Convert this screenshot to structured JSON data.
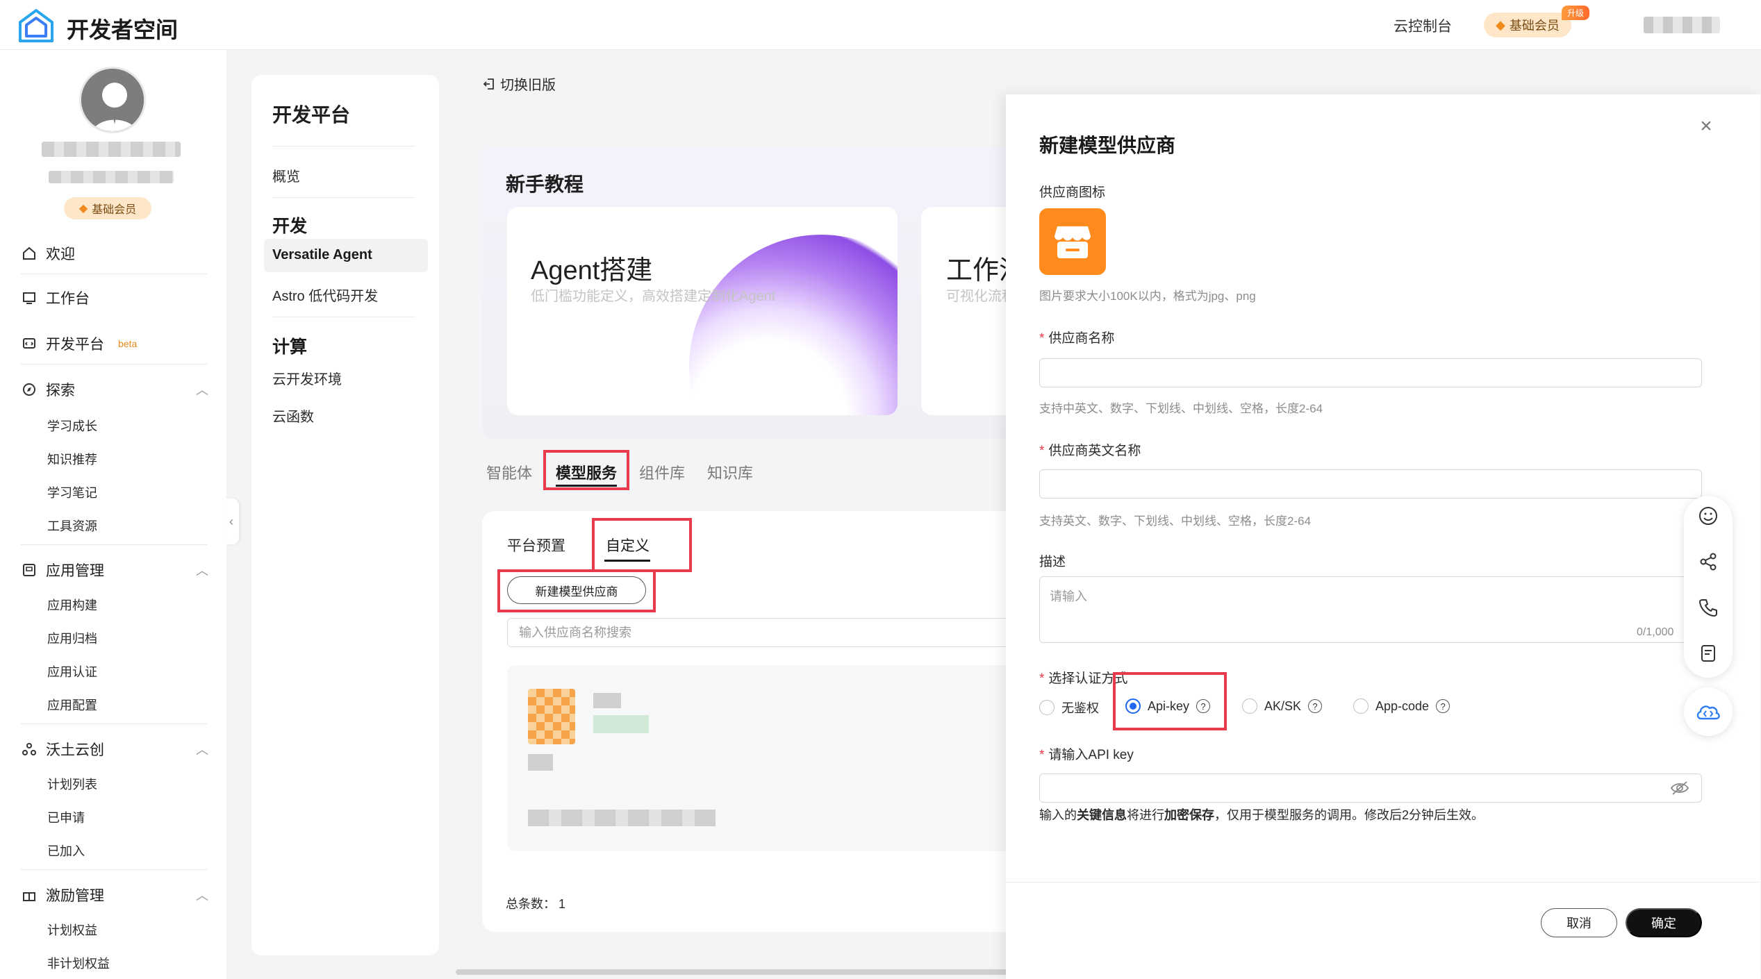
{
  "app": {
    "brand": "开发者空间"
  },
  "topbar": {
    "console": "云控制台",
    "member": "基础会员",
    "upgrade": "升级"
  },
  "sidebar": {
    "member": "基础会员",
    "beta": "beta",
    "groups": [
      {
        "label": "欢迎",
        "icon": "home-icon"
      },
      {
        "label": "工作台",
        "icon": "desktop-icon"
      },
      {
        "label": "开发平台",
        "icon": "code-icon"
      },
      {
        "label": "探索",
        "icon": "compass-icon",
        "items": [
          "学习成长",
          "知识推荐",
          "学习笔记",
          "工具资源"
        ]
      },
      {
        "label": "应用管理",
        "icon": "app-icon",
        "items": [
          "应用构建",
          "应用归档",
          "应用认证",
          "应用配置"
        ]
      },
      {
        "label": "沃土云创",
        "icon": "network-icon",
        "items": [
          "计划列表",
          "已申请",
          "已加入"
        ]
      },
      {
        "label": "激励管理",
        "icon": "gift-icon",
        "items": [
          "计划权益",
          "非计划权益"
        ]
      }
    ]
  },
  "dev_panel": {
    "title": "开发平台",
    "overview": "概览",
    "dev_head": "开发",
    "dev_items": [
      "Versatile Agent",
      "Astro 低代码开发"
    ],
    "compute_head": "计算",
    "compute_items": [
      "云开发环境",
      "云函数"
    ]
  },
  "main": {
    "switch_old": "切换旧版",
    "tutorial_title": "新手教程",
    "agent_title": "Agent搭建",
    "agent_desc": "低门槛功能定义，高效搭建定制化Agent",
    "flow_title": "工作流",
    "flow_desc": "可视化流程编排",
    "tabs": [
      "智能体",
      "模型服务",
      "组件库",
      "知识库"
    ],
    "sub_tabs": [
      "平台预置",
      "自定义"
    ],
    "new_supplier": "新建模型供应商",
    "search_placeholder": "输入供应商名称搜索",
    "total_label": "总条数：",
    "total_value": "1"
  },
  "drawer": {
    "title": "新建模型供应商",
    "icon_label": "供应商图标",
    "icon_hint": "图片要求大小100K以内，格式为jpg、png",
    "name_label": "供应商名称",
    "name_hint": "支持中英文、数字、下划线、中划线、空格，长度2-64",
    "en_name_label": "供应商英文名称",
    "en_name_hint": "支持英文、数字、下划线、中划线、空格，长度2-64",
    "desc_label": "描述",
    "desc_placeholder": "请输入",
    "desc_count": "0/1,000",
    "auth_label": "选择认证方式",
    "auth_options": [
      "无鉴权",
      "Api-key",
      "AK/SK",
      "App-code"
    ],
    "auth_selected": "Api-key",
    "apikey_label": "请输入API key",
    "key_note_1": "输入的",
    "key_note_b1": "关键信息",
    "key_note_2": "将进行",
    "key_note_b2": "加密保存",
    "key_note_3": "，仅用于模型服务的调用。修改后2分钟后生效。",
    "cancel": "取消",
    "confirm": "确定"
  },
  "colors": {
    "accent": "#1f66f2",
    "highlight": "#e83a4a",
    "icon_tile": "#ff8a1e"
  }
}
